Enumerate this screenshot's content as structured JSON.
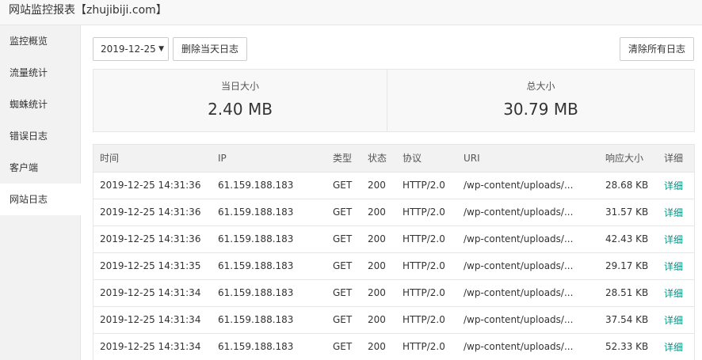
{
  "window": {
    "title": "网站监控报表【zhujibiji.com】"
  },
  "sidebar": {
    "items": [
      {
        "label": "监控概览"
      },
      {
        "label": "流量统计"
      },
      {
        "label": "蜘蛛统计"
      },
      {
        "label": "错误日志"
      },
      {
        "label": "客户端"
      },
      {
        "label": "网站日志"
      }
    ],
    "active": "网站日志"
  },
  "toolbar": {
    "date_value": "2019-12-25",
    "delete_day_label": "删除当天日志",
    "clear_all_label": "清除所有日志"
  },
  "stats": {
    "today": {
      "label": "当日大小",
      "value": "2.40 MB"
    },
    "total": {
      "label": "总大小",
      "value": "30.79 MB"
    }
  },
  "colors": {
    "accent": "#009688"
  },
  "table": {
    "headers": [
      "时间",
      "IP",
      "类型",
      "状态",
      "协议",
      "URI",
      "响应大小",
      "详细"
    ],
    "rows": [
      [
        "2019-12-25 14:31:36",
        "61.159.188.183",
        "GET",
        "200",
        "HTTP/2.0",
        "/wp-content/uploads/...",
        "28.68 KB",
        "详细"
      ],
      [
        "2019-12-25 14:31:36",
        "61.159.188.183",
        "GET",
        "200",
        "HTTP/2.0",
        "/wp-content/uploads/...",
        "31.57 KB",
        "详细"
      ],
      [
        "2019-12-25 14:31:36",
        "61.159.188.183",
        "GET",
        "200",
        "HTTP/2.0",
        "/wp-content/uploads/...",
        "42.43 KB",
        "详细"
      ],
      [
        "2019-12-25 14:31:35",
        "61.159.188.183",
        "GET",
        "200",
        "HTTP/2.0",
        "/wp-content/uploads/...",
        "29.17 KB",
        "详细"
      ],
      [
        "2019-12-25 14:31:34",
        "61.159.188.183",
        "GET",
        "200",
        "HTTP/2.0",
        "/wp-content/uploads/...",
        "28.51 KB",
        "详细"
      ],
      [
        "2019-12-25 14:31:34",
        "61.159.188.183",
        "GET",
        "200",
        "HTTP/2.0",
        "/wp-content/uploads/...",
        "37.54 KB",
        "详细"
      ],
      [
        "2019-12-25 14:31:34",
        "61.159.188.183",
        "GET",
        "200",
        "HTTP/2.0",
        "/wp-content/uploads/...",
        "52.33 KB",
        "详细"
      ]
    ]
  }
}
